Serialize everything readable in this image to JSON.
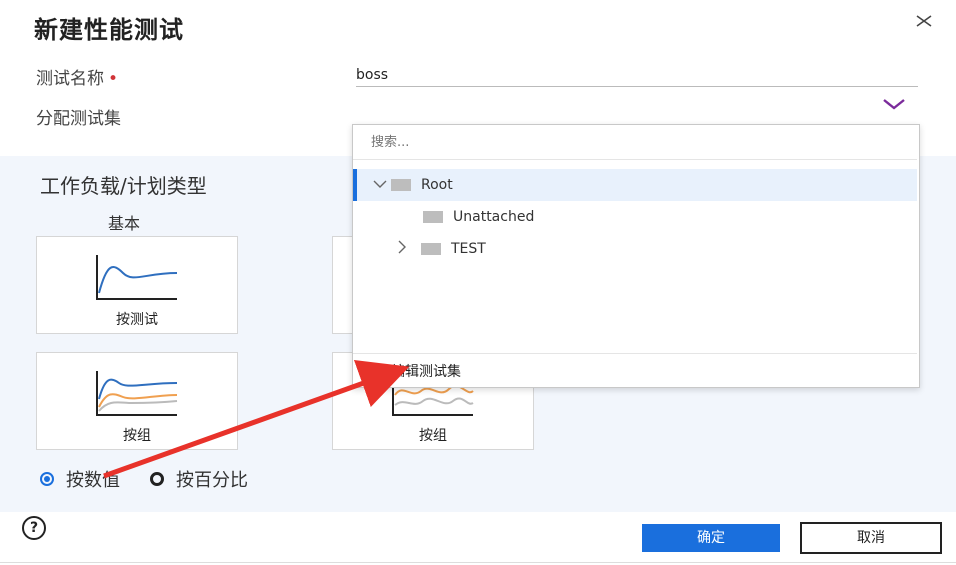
{
  "dialog": {
    "title": "新建性能测试",
    "close_icon": "close-icon"
  },
  "form": {
    "test_name_label": "测试名称",
    "required_marker": "•",
    "test_name_value": "boss",
    "assign_label": "分配测试集"
  },
  "workload": {
    "section_title": "工作负载/计划类型",
    "basic_label": "基本",
    "cards": [
      {
        "label": "按测试"
      },
      {
        "label": "按组"
      },
      {
        "label": "按组"
      }
    ],
    "radio_by_value": "按数值",
    "radio_by_percent": "按百分比"
  },
  "dropdown": {
    "search_placeholder": "搜索...",
    "items": [
      {
        "label": "Root",
        "expanded": true,
        "selected": true
      },
      {
        "label": "Unattached"
      },
      {
        "label": "TEST",
        "collapsed": true
      }
    ],
    "footer_label": "编辑测试集"
  },
  "footer": {
    "ok_label": "确定",
    "cancel_label": "取消",
    "help_icon": "help-icon"
  },
  "colors": {
    "accent": "#1a6fdd",
    "select_border": "#7b2b9b",
    "annotation_arrow": "#e8322a",
    "chart_blue": "#2f6fbf",
    "chart_orange": "#f0a050"
  }
}
